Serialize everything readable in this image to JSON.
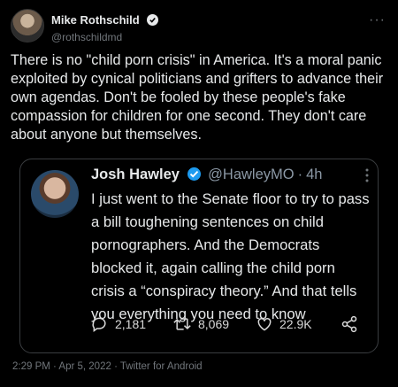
{
  "author": {
    "display_name": "Mike Rothschild",
    "handle": "@rothschildmd"
  },
  "more_glyph": "···",
  "tweet_text": "There is no \"child porn crisis\" in America. It's a moral panic exploited by cynical politicians and grifters to advance their own agendas. Don't be fooled by these people's fake compassion for children for one second. They don't care about anyone but themselves.",
  "quoted": {
    "display_name": "Josh Hawley",
    "handle": "@HawleyMO",
    "separator": "·",
    "time": "4h",
    "text": "I just went to the Senate floor to try to pass a bill toughening sentences on child pornographers. And the Democrats blocked it, again calling the child porn crisis a “conspiracy theory.” And that tells you everything you need to know",
    "replies": "2,181",
    "retweets": "8,069",
    "likes": "22.9K"
  },
  "footer": {
    "timestamp": "2:29 PM · Apr 5, 2022 · Twitter for Android"
  },
  "colors": {
    "background": "#000000",
    "text": "#e7e9ea",
    "muted": "#71767b",
    "verified_blue": "#1d9bf0"
  }
}
